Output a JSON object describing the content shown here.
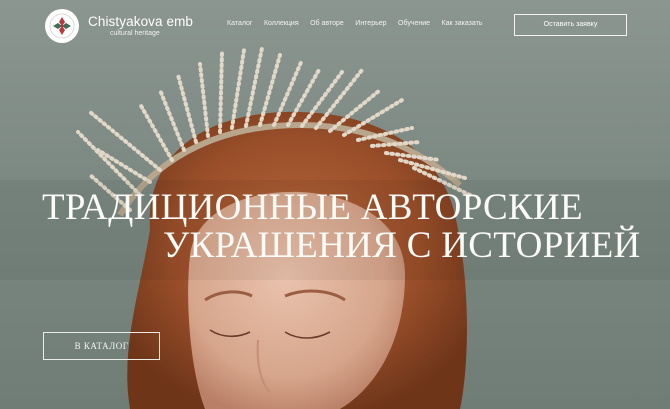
{
  "brand": {
    "name": "Chistyakova emb",
    "tagline": "cultural heritage",
    "logo_icon": "ornament-cross-icon"
  },
  "nav": {
    "items": [
      "Каталог",
      "Коллекция",
      "Об авторе",
      "Интерьер",
      "Обучение",
      "Как заказать"
    ]
  },
  "header": {
    "cta_label": "Оставить заявку"
  },
  "hero": {
    "title_line_1": "ТРАДИЦИОННЫЕ АВТОРСКИЕ",
    "title_line_2": "УКРАШЕНИЯ С ИСТОРИЕЙ",
    "button_label": "В КАТАЛОГ",
    "image_subject": "woman-with-pearl-kokoshnik-photo"
  },
  "colors": {
    "background": "#7e8a84",
    "text": "#ffffff",
    "logo_red": "#b8393e",
    "logo_green": "#3f6f57"
  }
}
